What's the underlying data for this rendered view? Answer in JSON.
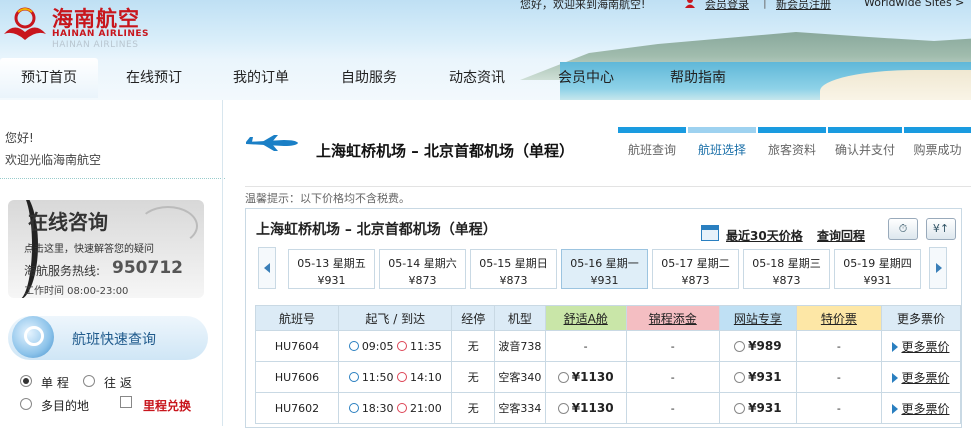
{
  "header": {
    "logo_cn": "海南航空",
    "logo_en": "HAINAN AIRLINES",
    "logo_en_shadow": "HAINAN AIRLINES",
    "welcome": "您好，欢迎来到海南航空!",
    "login": "会员登录",
    "divider": "|",
    "register": "新会员注册",
    "worldwide": "Worldwide Sites >"
  },
  "nav": {
    "items": [
      "预订首页",
      "在线预订",
      "我的订单",
      "自助服务",
      "动态资讯",
      "会员中心",
      "帮助指南"
    ]
  },
  "sidebar": {
    "greet1": "您好!",
    "greet2": "欢迎光临海南航空",
    "consult_title": "在线咨询",
    "consult_tip": "点击这里，快速解答您的疑问",
    "hotline_label": "海航服务热线:",
    "hotline_number": "950712",
    "hours": "工作时间 08:00-23:00",
    "quick_search": "航班快速查询",
    "trip_oneway": "单 程",
    "trip_round": "往 返",
    "trip_multi": "多目的地",
    "mileage": "里程兑换"
  },
  "main": {
    "route_title": "上海虹桥机场 – 北京首都机场（单程）",
    "steps": [
      "航班查询",
      "航班选择",
      "旅客资料",
      "确认并支付",
      "购票成功"
    ],
    "notice": "温馨提示：以下价格均不含税费。",
    "panel_title": "上海虹桥机场 – 北京首都机场（单程）",
    "link_30days": "最近30天价格",
    "link_return": "查询回程",
    "dates": [
      {
        "date": "05-13 星期五",
        "price": "¥931"
      },
      {
        "date": "05-14 星期六",
        "price": "¥873"
      },
      {
        "date": "05-15 星期日",
        "price": "¥873"
      },
      {
        "date": "05-16 星期一",
        "price": "¥931"
      },
      {
        "date": "05-17 星期二",
        "price": "¥873"
      },
      {
        "date": "05-18 星期三",
        "price": "¥873"
      },
      {
        "date": "05-19 星期四",
        "price": "¥931"
      }
    ],
    "table": {
      "headers": [
        "航班号",
        "起飞 / 到达",
        "经停",
        "机型",
        "舒适A舱",
        "锦程添金",
        "网站专享",
        "特价票",
        "更多票价"
      ],
      "rows": [
        {
          "flight": "HU7604",
          "dep": "09:05",
          "arr": "11:35",
          "stop": "无",
          "type": "波音738",
          "a": "-",
          "b": "-",
          "c": "¥989",
          "d": "-",
          "more": "更多票价"
        },
        {
          "flight": "HU7606",
          "dep": "11:50",
          "arr": "14:10",
          "stop": "无",
          "type": "空客340",
          "a": "¥1130",
          "b": "-",
          "c": "¥931",
          "d": "-",
          "more": "更多票价"
        },
        {
          "flight": "HU7602",
          "dep": "18:30",
          "arr": "21:00",
          "stop": "无",
          "type": "空客334",
          "a": "¥1130",
          "b": "-",
          "c": "¥931",
          "d": "-",
          "more": "更多票价"
        }
      ]
    }
  },
  "colors": {
    "brand_red": "#c8161d",
    "accent_blue": "#1a9be0",
    "comfort": "#c9e6a8",
    "bonus": "#f4bec2",
    "web_only": "#bfe0f4",
    "special": "#fde7a6"
  }
}
